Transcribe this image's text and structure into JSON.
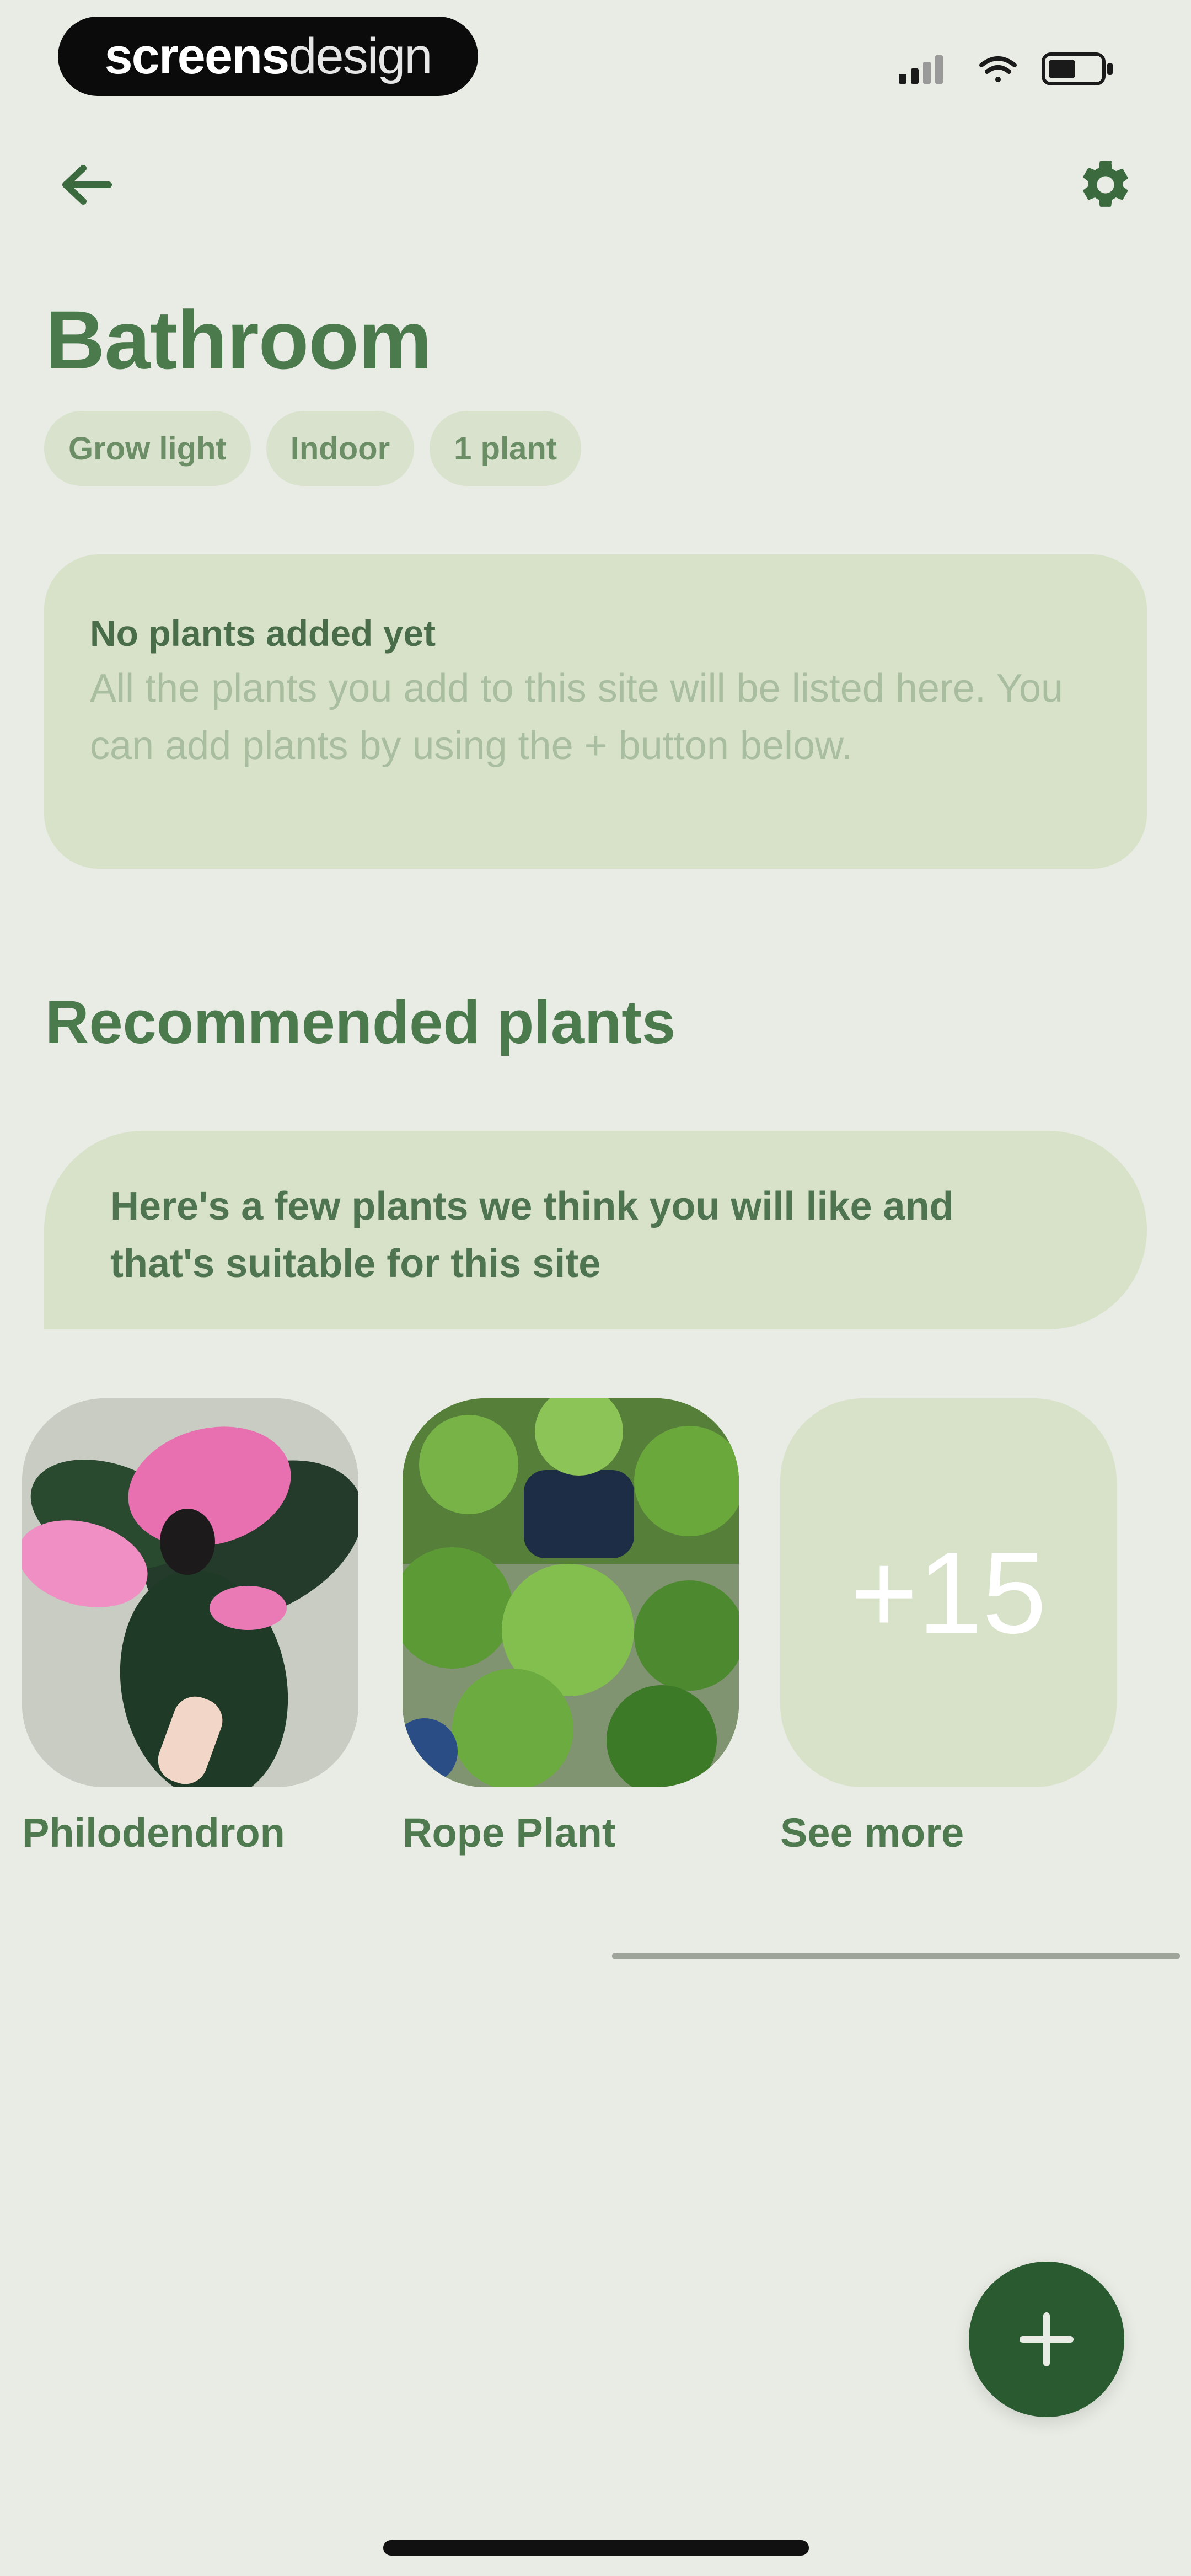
{
  "status_bar": {
    "brand_part1": "screens",
    "brand_part2": "design"
  },
  "header": {
    "back_icon": "arrow-left-icon",
    "settings_icon": "gear-icon"
  },
  "page_title": "Bathroom",
  "tags": [
    "Grow light",
    "Indoor",
    "1 plant"
  ],
  "empty_state": {
    "title": "No plants added yet",
    "body": "All the plants you add to this site will be listed here. You can add plants by using the + button below."
  },
  "recommended": {
    "title": "Recommended plants",
    "banner": "Here's a few plants we think you will like and that's suitable for this site",
    "plants": [
      {
        "name": "Philodendron"
      },
      {
        "name": "Rope Plant"
      }
    ],
    "more": {
      "count_label": "+15",
      "label": "See more"
    }
  },
  "fab": {
    "icon": "plus-icon"
  },
  "colors": {
    "background": "#e8ece4",
    "primary_dark": "#2a5a2f",
    "title_green": "#4b7a4d",
    "card": "#d7e2c8"
  }
}
